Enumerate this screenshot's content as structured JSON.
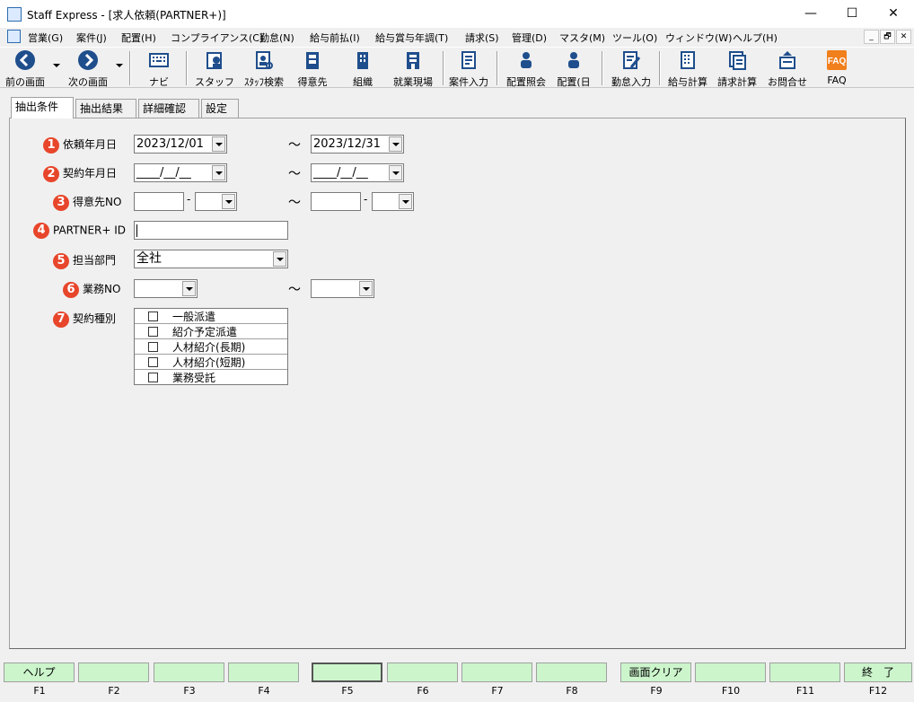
{
  "window": {
    "title": "Staff Express - [求人依頼(PARTNER+)]",
    "controls": {
      "minimize": "—",
      "maximize": "☐",
      "close": "✕"
    }
  },
  "menu": {
    "items": [
      "営業(G)",
      "案件(J)",
      "配置(H)",
      "コンプライアンス(C)",
      "勤怠(N)",
      "給与前払(I)",
      "給与賞与年調(T)",
      "請求(S)",
      "管理(D)",
      "マスタ(M)",
      "ツール(O)",
      "ウィンドウ(W)",
      "ヘルプ(H)"
    ],
    "mdi_controls": {
      "minimize": "_",
      "restore": "🗗",
      "close": "✕"
    }
  },
  "toolbar": {
    "back": "前の画面",
    "forward": "次の画面",
    "navi": "ナビ",
    "staff": "スタッフ",
    "staff_search": "ｽﾀｯﾌ検索",
    "client": "得意先",
    "organization": "組織",
    "worksite": "就業現場",
    "case_input": "案件入力",
    "placement_query": "配置照会",
    "placement_day": "配置(日",
    "attendance_input": "勤怠入力",
    "payroll": "給与計算",
    "billing": "請求計算",
    "inquiry": "お問合せ",
    "faq": "FAQ"
  },
  "tabs": [
    "抽出条件",
    "抽出結果",
    "詳細確認",
    "設定"
  ],
  "form": {
    "tilde": "～",
    "dash": "-",
    "request_date": {
      "num": "1",
      "label": "依頼年月日",
      "from": "2023/12/01",
      "to": "2023/12/31"
    },
    "contract_date": {
      "num": "2",
      "label": "契約年月日",
      "from": "____/__/__",
      "to": "____/__/__"
    },
    "client_no": {
      "num": "3",
      "label": "得意先NO",
      "from_a": "",
      "from_b": "",
      "to_a": "",
      "to_b": ""
    },
    "partner_id": {
      "num": "4",
      "label": "PARTNER+ ID",
      "value": ""
    },
    "department": {
      "num": "5",
      "label": "担当部門",
      "value": "全社"
    },
    "business_no": {
      "num": "6",
      "label": "業務NO",
      "from": "",
      "to": ""
    },
    "contract_type": {
      "num": "7",
      "label": "契約種別",
      "options": [
        {
          "label": "一般派遣",
          "checked": false
        },
        {
          "label": "紹介予定派遣",
          "checked": false
        },
        {
          "label": "人材紹介(長期)",
          "checked": false
        },
        {
          "label": "人材紹介(短期)",
          "checked": false
        },
        {
          "label": "業務受託",
          "checked": false
        }
      ]
    }
  },
  "function_keys": [
    {
      "key": "F1",
      "label": "ヘルプ"
    },
    {
      "key": "F2",
      "label": ""
    },
    {
      "key": "F3",
      "label": ""
    },
    {
      "key": "F4",
      "label": ""
    },
    {
      "key": "F5",
      "label": ""
    },
    {
      "key": "F6",
      "label": ""
    },
    {
      "key": "F7",
      "label": ""
    },
    {
      "key": "F8",
      "label": ""
    },
    {
      "key": "F9",
      "label": "画面クリア"
    },
    {
      "key": "F10",
      "label": ""
    },
    {
      "key": "F11",
      "label": ""
    },
    {
      "key": "F12",
      "label": "終　了"
    }
  ],
  "colors": {
    "badge": "#e8462b",
    "fkey_bg": "#ccf5cc",
    "nav_arrow": "#1f4e8c",
    "faq": "#f07f1c"
  }
}
